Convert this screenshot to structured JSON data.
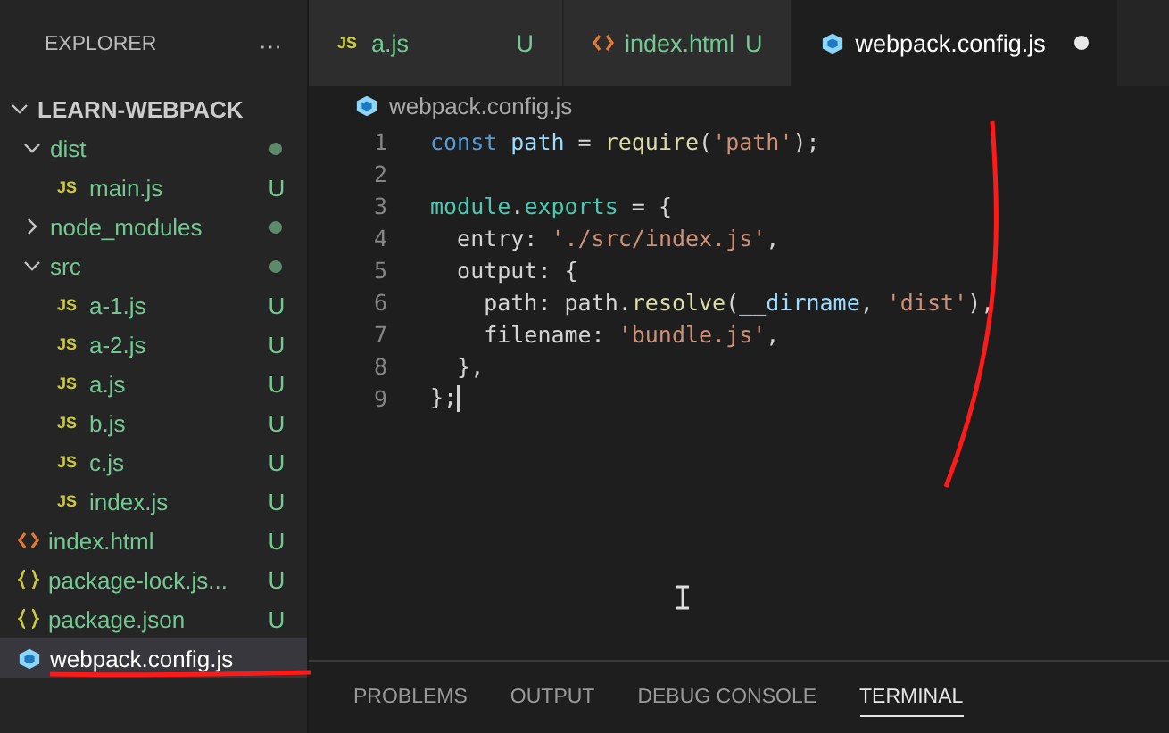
{
  "sidebar": {
    "title": "EXPLORER",
    "more": "···",
    "root": {
      "label": "LEARN-WEBPACK",
      "expanded": true,
      "children": [
        {
          "label": "dist",
          "kind": "folder",
          "expanded": true,
          "changed": true,
          "selected": false,
          "children": [
            {
              "label": "main.js",
              "kind": "js",
              "icon_label": "JS",
              "status": "U",
              "selected": false
            }
          ]
        },
        {
          "label": "node_modules",
          "kind": "folder",
          "expanded": false,
          "changed": true,
          "selected": false
        },
        {
          "label": "src",
          "kind": "folder",
          "expanded": true,
          "changed": true,
          "selected": false,
          "children": [
            {
              "label": "a-1.js",
              "kind": "js",
              "icon_label": "JS",
              "status": "U",
              "selected": false
            },
            {
              "label": "a-2.js",
              "kind": "js",
              "icon_label": "JS",
              "status": "U",
              "selected": false
            },
            {
              "label": "a.js",
              "kind": "js",
              "icon_label": "JS",
              "status": "U",
              "selected": false
            },
            {
              "label": "b.js",
              "kind": "js",
              "icon_label": "JS",
              "status": "U",
              "selected": false
            },
            {
              "label": "c.js",
              "kind": "js",
              "icon_label": "JS",
              "status": "U",
              "selected": false
            },
            {
              "label": "index.js",
              "kind": "js",
              "icon_label": "JS",
              "status": "U",
              "selected": false
            }
          ]
        },
        {
          "label": "index.html",
          "kind": "html",
          "status": "U",
          "selected": false
        },
        {
          "label": "package-lock.js...",
          "kind": "json",
          "status": "U",
          "selected": false
        },
        {
          "label": "package.json",
          "kind": "json",
          "status": "U",
          "selected": false
        },
        {
          "label": "webpack.config.js",
          "kind": "webpack",
          "selected": true
        }
      ]
    }
  },
  "tabs": [
    {
      "label": "a.js",
      "kind": "js",
      "icon_label": "JS",
      "status": "U",
      "dirty": false,
      "selected": false
    },
    {
      "label": "index.html",
      "kind": "html",
      "status": "U",
      "dirty": false,
      "selected": false
    },
    {
      "label": "webpack.config.js",
      "kind": "webpack",
      "dirty": true,
      "selected": true
    }
  ],
  "breadcrumb": {
    "label": "webpack.config.js",
    "kind": "webpack"
  },
  "code": [
    {
      "number": "1",
      "tokens": [
        {
          "kind": "keyword",
          "text": "const "
        },
        {
          "kind": "variable",
          "text": "path"
        },
        {
          "kind": "plain",
          "text": " = "
        },
        {
          "kind": "function",
          "text": "require"
        },
        {
          "kind": "plain",
          "text": "("
        },
        {
          "kind": "string",
          "text": "'path'"
        },
        {
          "kind": "plain",
          "text": ");"
        }
      ]
    },
    {
      "number": "2"
    },
    {
      "number": "3",
      "tokens": [
        {
          "kind": "type",
          "text": "module"
        },
        {
          "kind": "plain",
          "text": "."
        },
        {
          "kind": "type",
          "text": "exports"
        },
        {
          "kind": "plain",
          "text": " = {"
        }
      ]
    },
    {
      "number": "4",
      "tokens": [
        {
          "kind": "plain",
          "text": "  entry: "
        },
        {
          "kind": "string",
          "text": "'./src/index.js'"
        },
        {
          "kind": "plain",
          "text": ","
        }
      ]
    },
    {
      "number": "5",
      "tokens": [
        {
          "kind": "plain",
          "text": "  output: {"
        }
      ]
    },
    {
      "number": "6",
      "tokens": [
        {
          "kind": "plain",
          "text": "    path: path."
        },
        {
          "kind": "function",
          "text": "resolve"
        },
        {
          "kind": "plain",
          "text": "("
        },
        {
          "kind": "variable",
          "text": "__dirname"
        },
        {
          "kind": "plain",
          "text": ", "
        },
        {
          "kind": "string",
          "text": "'dist'"
        },
        {
          "kind": "plain",
          "text": "),"
        }
      ]
    },
    {
      "number": "7",
      "tokens": [
        {
          "kind": "plain",
          "text": "    filename: "
        },
        {
          "kind": "string",
          "text": "'bundle.js'"
        },
        {
          "kind": "plain",
          "text": ","
        }
      ]
    },
    {
      "number": "8",
      "tokens": [
        {
          "kind": "plain",
          "text": "  },"
        }
      ]
    },
    {
      "number": "9",
      "tokens": [
        {
          "kind": "plain",
          "text": "};"
        }
      ],
      "cursor": true
    }
  ],
  "panel_tabs": [
    {
      "label": "PROBLEMS",
      "selected": false
    },
    {
      "label": "OUTPUT",
      "selected": false
    },
    {
      "label": "DEBUG CONSOLE",
      "selected": false
    },
    {
      "label": "TERMINAL",
      "selected": true
    }
  ]
}
